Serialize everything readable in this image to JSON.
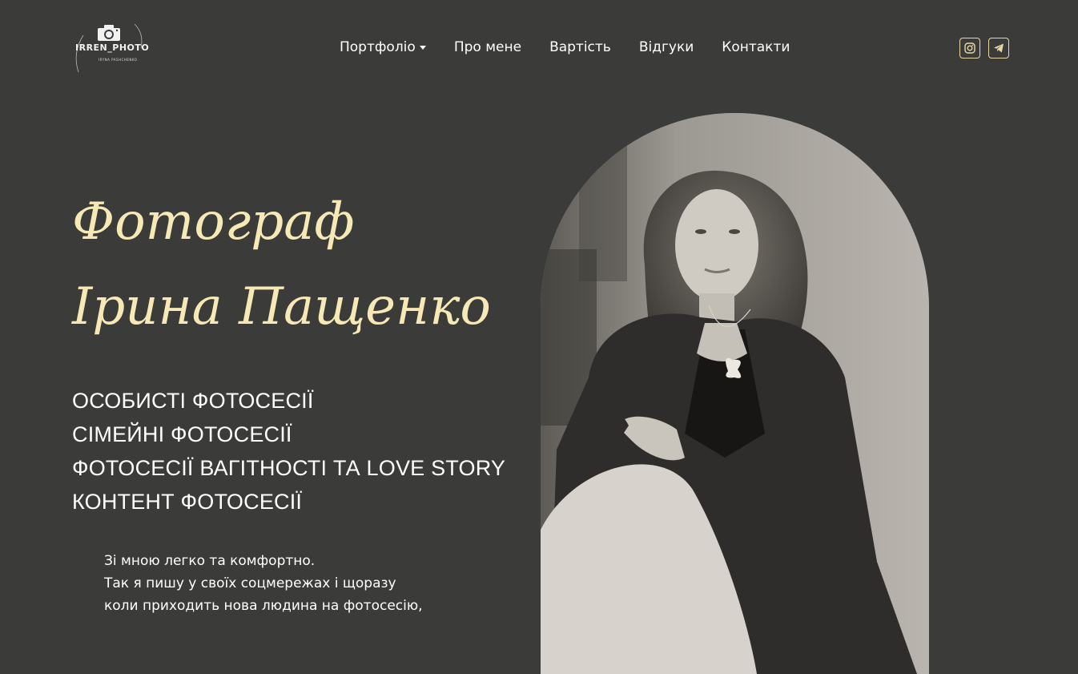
{
  "header": {
    "logo": {
      "text": "IRREN_PHOTO",
      "subtext": "IRYNA PASHCHENKO"
    },
    "nav": [
      {
        "label": "Портфоліо",
        "dropdown": true
      },
      {
        "label": "Про мене"
      },
      {
        "label": "Вартість"
      },
      {
        "label": "Відгуки"
      },
      {
        "label": "Контакти"
      }
    ],
    "social": [
      {
        "name": "instagram-icon"
      },
      {
        "name": "telegram-icon"
      }
    ]
  },
  "hero": {
    "title_line1": "Фотограф",
    "title_line2": "Ірина Пащенко",
    "services": [
      "ОСОБИСТІ ФОТОСЕСІЇ",
      "СІМЕЙНІ ФОТОСЕСІЇ",
      "ФОТОСЕСІЇ ВАГІТНОСТІ ТА LOVE STORY",
      "КОНТЕНТ ФОТОСЕСІЇ"
    ],
    "intro_lines": [
      "Зі мною легко та комфортно.",
      "Так я пишу у своїх соцмережах і щоразу",
      "коли приходить нова людина на фотосесію,"
    ]
  },
  "colors": {
    "background": "#3b3b39",
    "accent": "#f6e9b5",
    "icon_border": "#e7d9a4",
    "text": "#ffffff"
  }
}
